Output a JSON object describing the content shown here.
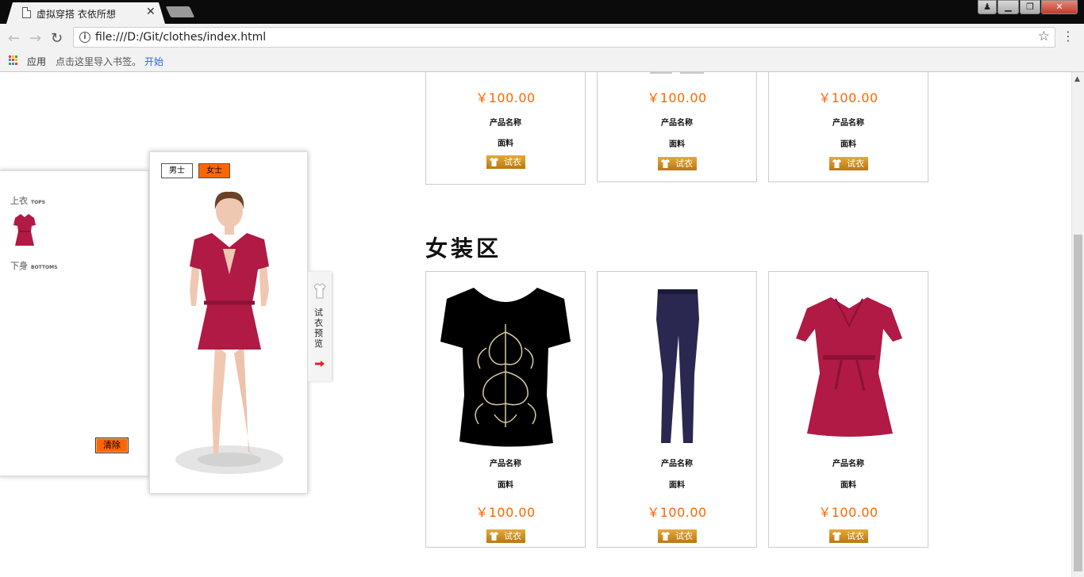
{
  "browser": {
    "tab_title": "虚拟穿搭 衣依所想",
    "url": "file:///D:/Git/clothes/index.html",
    "bookmarks": {
      "apps": "应用",
      "import_hint": "点击这里导入书签。",
      "start": "开始"
    }
  },
  "wardrobe": {
    "tops_label": "上衣",
    "tops_sub": "TOPS",
    "bottoms_label": "下身",
    "bottoms_sub": "BOTTOMS",
    "clear_label": "清除"
  },
  "model": {
    "male_label": "男士",
    "female_label": "女士",
    "selected": "女士"
  },
  "preview_tab": {
    "label": "试衣预览"
  },
  "section": {
    "title": "女装区"
  },
  "products_top": [
    {
      "price": "￥100.00",
      "name": "产品名称",
      "material": "面料",
      "try_label": "试衣"
    },
    {
      "price": "￥100.00",
      "name": "产品名称",
      "material": "面料",
      "try_label": "试衣"
    },
    {
      "price": "￥100.00",
      "name": "产品名称",
      "material": "面料",
      "try_label": "试衣"
    }
  ],
  "products_women": [
    {
      "item": "black-tshirt",
      "name": "产品名称",
      "material": "面料",
      "price": "￥100.00",
      "try_label": "试衣"
    },
    {
      "item": "navy-pants",
      "name": "产品名称",
      "material": "面料",
      "price": "￥100.00",
      "try_label": "试衣"
    },
    {
      "item": "red-dress",
      "name": "产品名称",
      "material": "面料",
      "price": "￥100.00",
      "try_label": "试衣"
    }
  ],
  "colors": {
    "accent": "#ff6600",
    "try_button": "#d4961e",
    "dress": "#b01a45",
    "pants": "#2a2850"
  }
}
